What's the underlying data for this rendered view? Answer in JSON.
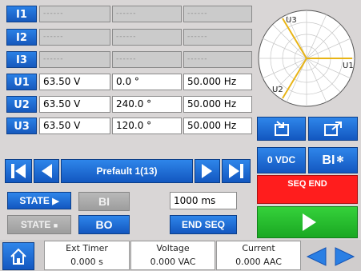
{
  "channels": [
    {
      "id": "I1",
      "c1": "------",
      "c2": "------",
      "c3": "------",
      "active": false
    },
    {
      "id": "I2",
      "c1": "------",
      "c2": "------",
      "c3": "------",
      "active": false
    },
    {
      "id": "I3",
      "c1": "------",
      "c2": "------",
      "c3": "------",
      "active": false
    },
    {
      "id": "U1",
      "c1": "63.50 V",
      "c2": "0.0 °",
      "c3": "50.000 Hz",
      "active": true
    },
    {
      "id": "U2",
      "c1": "63.50 V",
      "c2": "240.0 °",
      "c3": "50.000 Hz",
      "active": true
    },
    {
      "id": "U3",
      "c1": "63.50 V",
      "c2": "120.0 °",
      "c3": "50.000 Hz",
      "active": true
    }
  ],
  "phasor": {
    "u1": "U1",
    "u2": "U2",
    "u3": "U3",
    "color": "#e8b416"
  },
  "nav": {
    "title": "Prefault 1(13)"
  },
  "controls": {
    "state_label": "STATE",
    "state2_label": "STATE",
    "bi_label": "BI",
    "bo_label": "BO",
    "time_value": "1000 ms",
    "end_seq_label": "END SEQ"
  },
  "right_panel": {
    "vdc_label": "0 VDC",
    "bi_settings_label": "BI",
    "seq_end_label": "SEQ END",
    "seq_end_color": "#ff1d1d",
    "play_color": "#22c02a"
  },
  "footer": {
    "ext_timer_label": "Ext Timer",
    "ext_timer_value": "0.000 s",
    "voltage_label": "Voltage",
    "voltage_value": "0.000 VAC",
    "current_label": "Current",
    "current_value": "0.000 AAC"
  },
  "accent_color": "#1f6fd8"
}
